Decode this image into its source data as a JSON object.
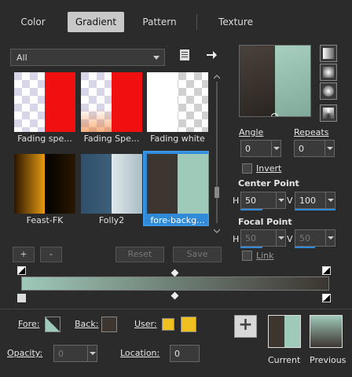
{
  "tabs": [
    {
      "label": "Color"
    },
    {
      "label": "Gradient"
    },
    {
      "label": "Pattern"
    },
    {
      "label": "Texture"
    }
  ],
  "category": {
    "value": "All"
  },
  "thumbnails": [
    {
      "label": "Fading spe..."
    },
    {
      "label": "Fading Spe..."
    },
    {
      "label": "Fading white"
    },
    {
      "label": "Feast-FK"
    },
    {
      "label": "Folly2"
    },
    {
      "label": "fore-backg..."
    }
  ],
  "editor": {
    "add_label": "+",
    "remove_label": "-",
    "reset_label": "Reset",
    "save_label": "Save"
  },
  "settings": {
    "angle_label": "Angle",
    "angle_value": "0",
    "repeats_label": "Repeats",
    "repeats_value": "0",
    "invert_label": "Invert",
    "center_label": "Center Point",
    "center_h_label": "H",
    "center_h": "50",
    "center_v_label": "V",
    "center_v": "100",
    "focal_label": "Focal Point",
    "focal_h_label": "H",
    "focal_h": "50",
    "focal_v_label": "V",
    "focal_v": "50",
    "link_label": "Link"
  },
  "footer": {
    "fore_label": "Fore:",
    "back_label": "Back:",
    "user_label": "User:",
    "opacity_label": "Opacity:",
    "opacity_value": "0",
    "location_label": "Location:",
    "location_value": "0",
    "current_label": "Current",
    "previous_label": "Previous",
    "plus_label": "+"
  },
  "colors": {
    "accent": "#2f8bd8",
    "foreground": "#9fc9b9",
    "background": "#3c3530",
    "user1": "#f0c020",
    "user2": "#f0c020"
  }
}
